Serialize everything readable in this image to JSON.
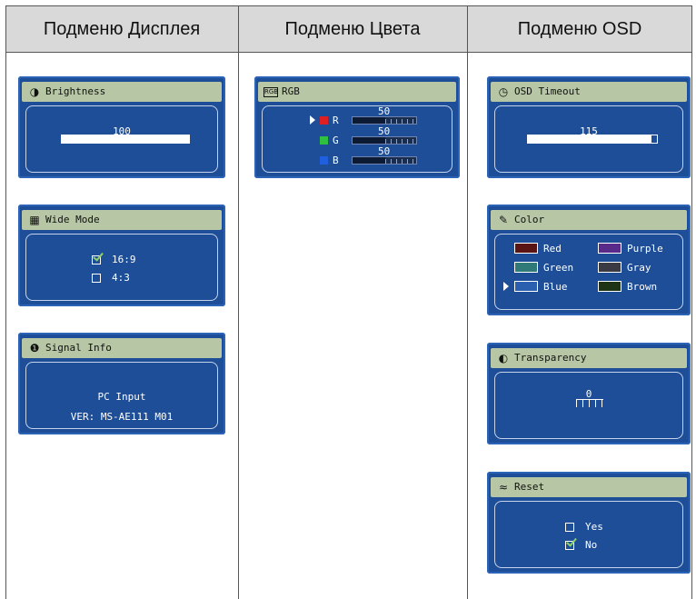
{
  "headers": [
    "Подменю Дисплея",
    "Подменю Цвета",
    "Подменю OSD"
  ],
  "brightness": {
    "title": "Brightness",
    "icon": "half-circle-icon",
    "value_label": "100",
    "level": 100
  },
  "wide_mode": {
    "title": "Wide Mode",
    "icon": "wide-mode-icon",
    "options": [
      {
        "label": "16:9",
        "checked": true
      },
      {
        "label": "4:3",
        "checked": false
      }
    ]
  },
  "signal_info": {
    "title": "Signal Info",
    "icon": "info-icon",
    "line1": "PC Input",
    "line2": "VER: MS-AE111 M01"
  },
  "rgb": {
    "title": "RGB",
    "icon": "rgb-icon",
    "channels": [
      {
        "label": "R",
        "value": "50",
        "color": "#e02020",
        "selected": true
      },
      {
        "label": "G",
        "value": "50",
        "color": "#30c040",
        "selected": false
      },
      {
        "label": "B",
        "value": "50",
        "color": "#2060e0",
        "selected": false
      }
    ]
  },
  "osd_timeout": {
    "title": "OSD Timeout",
    "icon": "clock-icon",
    "value_label": "115",
    "level": 96
  },
  "color": {
    "title": "Color",
    "icon": "palette-icon",
    "options": [
      {
        "label": "Red",
        "swatch": "#5a1414",
        "selected": false
      },
      {
        "label": "Purple",
        "swatch": "#5a2a8a",
        "selected": false
      },
      {
        "label": "Green",
        "swatch": "#2f7a78",
        "selected": false
      },
      {
        "label": "Gray",
        "swatch": "#3a3a44",
        "selected": false
      },
      {
        "label": "Blue",
        "swatch": "#2a5fb0",
        "selected": true
      },
      {
        "label": "Brown",
        "swatch": "#1f3315",
        "selected": false
      }
    ]
  },
  "transparency": {
    "title": "Transparency",
    "icon": "transparency-icon",
    "value_label": "0"
  },
  "reset": {
    "title": "Reset",
    "icon": "reset-icon",
    "options": [
      {
        "label": "Yes",
        "checked": false
      },
      {
        "label": "No",
        "checked": true
      }
    ]
  }
}
